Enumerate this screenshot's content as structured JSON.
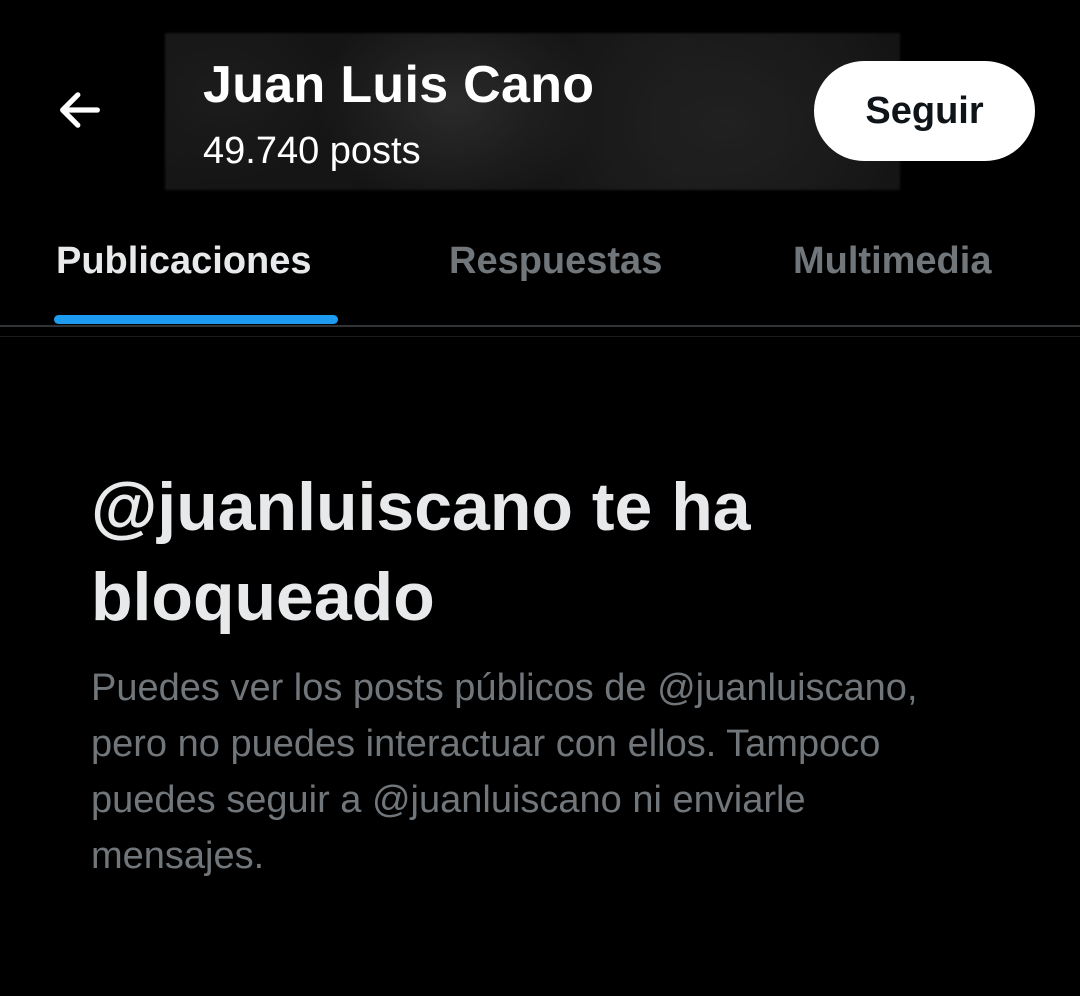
{
  "header": {
    "profile_name": "Juan Luis Cano",
    "post_count": "49.740 posts",
    "follow_label": "Seguir",
    "back_icon": "arrow-left-icon"
  },
  "tabs": [
    {
      "label": "Publicaciones",
      "active": true
    },
    {
      "label": "Respuestas",
      "active": false
    },
    {
      "label": "Multimedia",
      "active": false
    }
  ],
  "blocked": {
    "title": "@juanluiscano te ha bloqueado",
    "description": "Puedes ver los posts públicos de @juanluiscano, pero no puedes interactuar con ellos. Tampoco puedes seguir a @juanluiscano ni enviarle mensajes."
  },
  "colors": {
    "background": "#000000",
    "accent": "#1d9bf0",
    "muted_text": "#71767b",
    "primary_text": "#e7e9ea"
  }
}
